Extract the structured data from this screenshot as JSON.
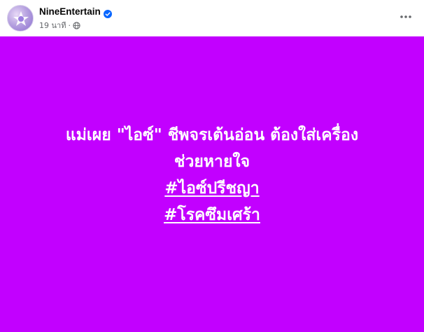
{
  "post": {
    "page_name": "NineEntertain",
    "timestamp": "19 นาที",
    "separator": "·",
    "privacy_icon": "globe-icon",
    "verified_icon": "verified-badge-icon",
    "more_icon": "more-options-icon"
  },
  "banner": {
    "background_color": "#c200ff",
    "headline_line1": "แม่เผย \"ไอซ์\" ชีพจรเต้นอ่อน ต้องใส่เครื่อง",
    "headline_line2": "ช่วยหายใจ",
    "hashtags": [
      "#ไอซ์ปรีชญา",
      "#โรคซึมเศร้า"
    ]
  }
}
